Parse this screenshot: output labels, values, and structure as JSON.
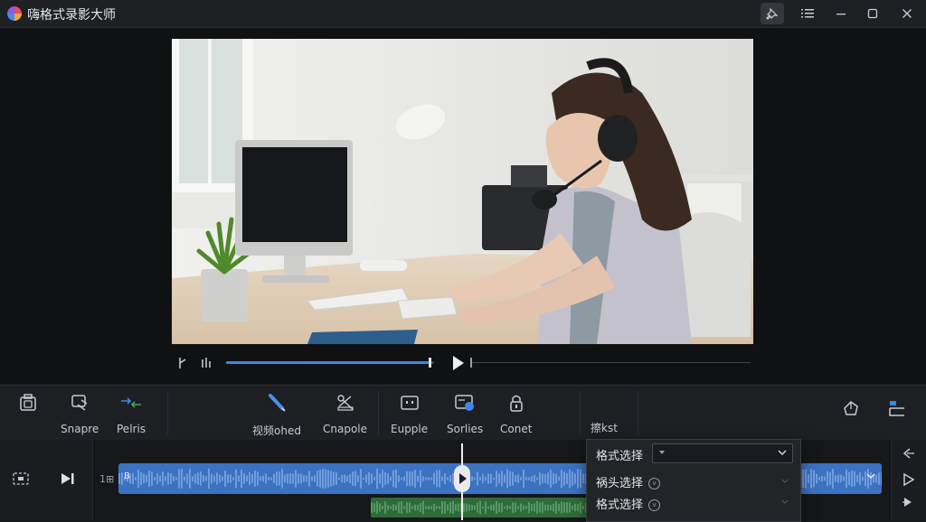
{
  "window": {
    "title": "嗨格式录影大师"
  },
  "player": {
    "progress": 0.54
  },
  "toolbar": {
    "items": [
      {
        "label": "",
        "icon": "screenshot-icon"
      },
      {
        "label": "Snapre",
        "icon": "annotate-icon"
      },
      {
        "label": "Pelris",
        "icon": "split-arrows-icon"
      },
      {
        "label": "视频ohed",
        "icon": "pen-icon"
      },
      {
        "label": "Cnapole",
        "icon": "cut-icon"
      },
      {
        "label": "Eupple",
        "icon": "frame-icon"
      },
      {
        "label": "Sorlies",
        "icon": "subtitle-icon"
      },
      {
        "label": "Conet",
        "icon": "lock-icon"
      },
      {
        "label": "擦kst",
        "icon": ""
      }
    ]
  },
  "dropdown": {
    "rows": [
      {
        "label": "格式选择"
      },
      {
        "label": "祸头选择"
      },
      {
        "label": "格式选择"
      }
    ]
  },
  "colors": {
    "accent": "#3f86e8",
    "clip_blue": "#3b72c2",
    "clip_green": "#2f6b3a",
    "background": "#17181b"
  }
}
